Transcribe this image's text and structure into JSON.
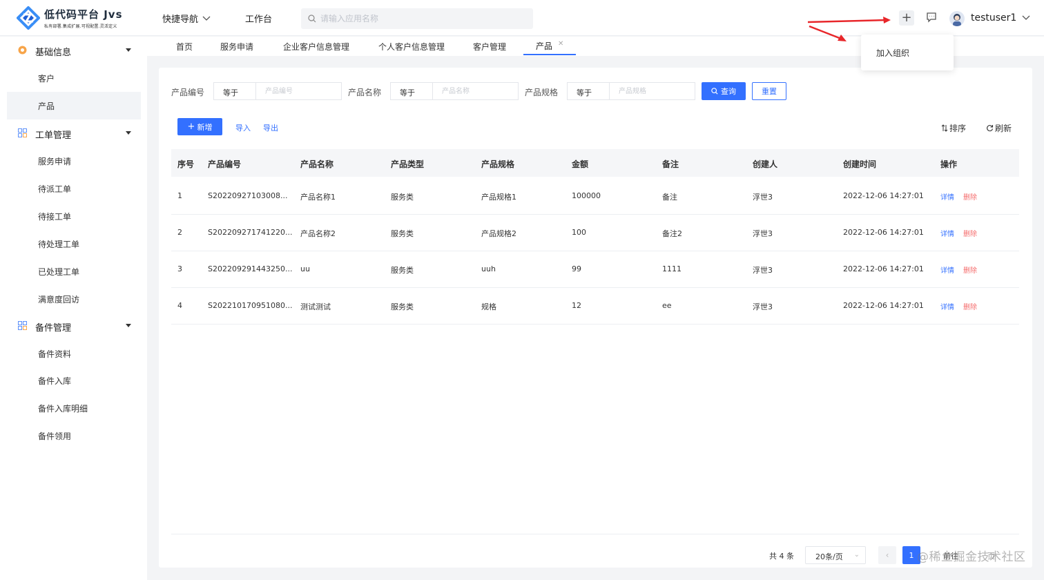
{
  "header": {
    "logo_title": "低代码平台 Jvs",
    "logo_subtitle": "私有部署.集成扩展.可视配置.灵活定义",
    "quick_nav": "快捷导航",
    "workbench": "工作台",
    "search_placeholder": "请输入应用名称",
    "username": "testuser1"
  },
  "popover": {
    "item": "加入组织"
  },
  "sidebar": {
    "groups": [
      {
        "label": "基础信息",
        "items": [
          "客户",
          "产品"
        ]
      },
      {
        "label": "工单管理",
        "items": [
          "服务申请",
          "待派工单",
          "待接工单",
          "待处理工单",
          "已处理工单",
          "满意度回访"
        ]
      },
      {
        "label": "备件管理",
        "items": [
          "备件资料",
          "备件入库",
          "备件入库明细",
          "备件领用"
        ]
      }
    ],
    "active_item": "产品"
  },
  "tabs": [
    "首页",
    "服务申请",
    "企业客户信息管理",
    "个人客户信息管理",
    "客户管理",
    "产品"
  ],
  "filters": {
    "labels": [
      "产品编号",
      "产品名称",
      "产品规格"
    ],
    "operator": "等于",
    "placeholders": [
      "产品编号",
      "产品名称",
      "产品规格"
    ],
    "query_label": "查询",
    "reset_label": "重置"
  },
  "toolbar": {
    "add_label": "新增",
    "import_label": "导入",
    "export_label": "导出",
    "sort_label": "排序",
    "refresh_label": "刷新"
  },
  "table": {
    "columns": [
      "序号",
      "产品编号",
      "产品名称",
      "产品类型",
      "产品规格",
      "金额",
      "备注",
      "创建人",
      "创建时间",
      "操作"
    ],
    "rows": [
      [
        "1",
        "S20220927103008...",
        "产品名称1",
        "服务类",
        "产品规格1",
        "100000",
        "备注",
        "浮世3",
        "2022-12-06 14:27:01"
      ],
      [
        "2",
        "S202209271741220...",
        "产品名称2",
        "服务类",
        "产品规格2",
        "100",
        "备注2",
        "浮世3",
        "2022-12-06 14:27:01"
      ],
      [
        "3",
        "S202209291443250...",
        "uu",
        "服务类",
        "uuh",
        "99",
        "1111",
        "浮世3",
        "2022-12-06 14:27:01"
      ],
      [
        "4",
        "S202210170951080...",
        "测试测试",
        "服务类",
        "规格",
        "12",
        "ee",
        "浮世3",
        "2022-12-06 14:27:01"
      ]
    ],
    "action_detail": "详情",
    "action_delete": "删除"
  },
  "pagination": {
    "total": "共 4 条",
    "page_size": "20条/页",
    "current": "1",
    "goto": "前往",
    "next_text": "页"
  },
  "watermark": "@稀土掘金技术社区",
  "colors": {
    "primary": "#3370ff",
    "danger": "#f56c6c",
    "arrow": "#e8262a"
  }
}
